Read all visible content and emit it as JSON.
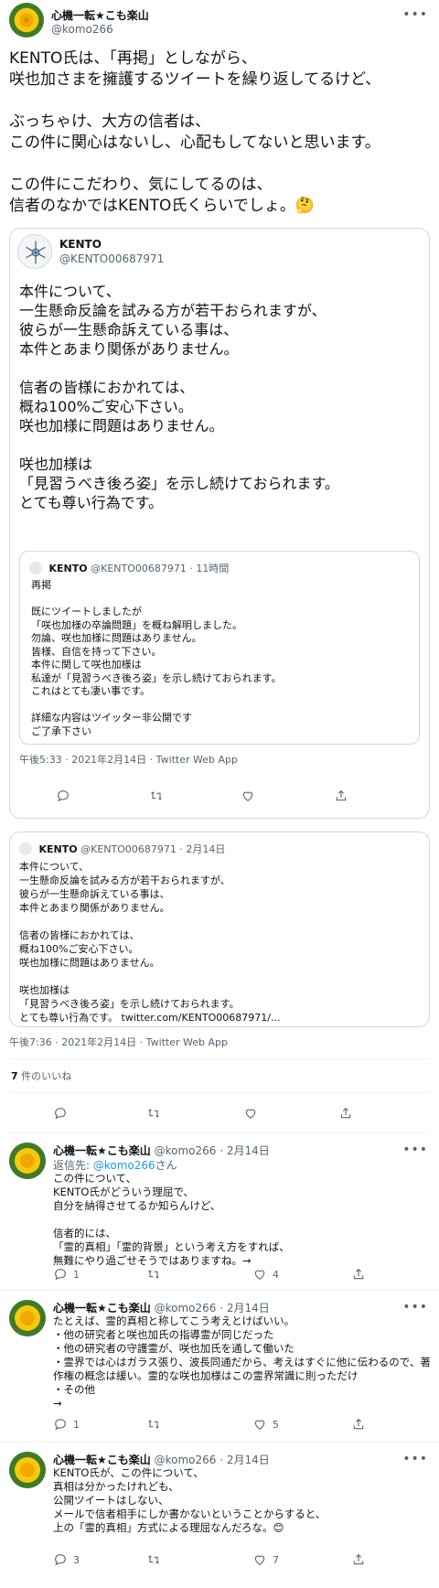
{
  "main": {
    "name": "心機一転★こも楽山",
    "handle": "@komo266",
    "text": "KENTO氏は、「再掲」としながら、\n咲也加さまを擁護するツイートを繰り返してるけど、\n\nぶっちゃけ、大方の信者は、\nこの件に関心はないし、心配もしてないと思います。\n\nこの件にこだわり、気にしてるのは、\n信者のなかではKENTO氏くらいでしょ。🤔",
    "time": "午後7:36 · 2021年2月14日 · Twitter Web App",
    "likes_count": "7",
    "likes_label": " 件のいいね"
  },
  "quote_big": {
    "name": "KENTO",
    "handle": "@KENTO00687971",
    "text": "本件について、\n一生懸命反論を試みる方が若干おられますが、\n彼らが一生懸命訴えている事は、\n本件とあまり関係がありません。\n\n信者の皆様におかれては、\n概ね100%ご安心下さい。\n咲也加様に問題はありません。\n\n咲也加様は\n「見習うべき後ろ姿」を示し続けておられます。\nとても尊い行為です。",
    "time": "午後5:33 · 2021年2月14日 · Twitter Web App",
    "inner": {
      "name": "KENTO",
      "handle": "@KENTO00687971 · 11時間",
      "text": "再掲\n\n既にツイートしましたが\n「咲也加様の卒論問題」を概ね解明しました。\n勿論、咲也加様に問題はありません。\n皆様、自信を持って下さい。\n本件に関して咲也加様は\n私達が「見習うべき後ろ姿」を示し続けておられます。\nこれはとても凄い事です。\n\n詳細な内容はツイッター非公開です\nご了承下さい"
    }
  },
  "quote_small": {
    "name": "KENTO",
    "handle": "@KENTO00687971 · 2月14日",
    "text": "本件について、\n一生懸命反論を試みる方が若干おられますが、\n彼らが一生懸命訴えている事は、\n本件とあまり関係がありません。\n\n信者の皆様におかれては、\n概ね100%ご安心下さい。\n咲也加様に問題はありません。\n\n咲也加様は\n「見習うべき後ろ姿」を示し続けておられます。\nとても尊い行為です。 twitter.com/KENTO00687971/..."
  },
  "replies": [
    {
      "name": "心機一転★こも楽山",
      "handle": "@komo266 · 2月14日",
      "replyto_prefix": "返信先: ",
      "replyto_handle": "@komo266",
      "replyto_suffix": "さん",
      "text": "この件について、\nKENTO氏がどういう理屈で、\n自分を納得させてるか知らんけど、\n\n信者的には、\n「霊的真相」「霊的背景」という考え方をすれば、\n無難にやり過ごせそうではありますね。→",
      "reply_count": "1",
      "like_count": "4"
    },
    {
      "name": "心機一転★こも楽山",
      "handle": "@komo266 · 2月14日",
      "text": "たとえば、霊的真相と称してこう考えとけばいい。\n・他の研究者と咲也加氏の指導霊が同じだった\n・他の研究者の守護霊が、咲也加氏を通して働いた\n・霊界では心はガラス張り、波長同通だから、考えはすぐに他に伝わるので、著作権の概念は緩い。霊的な咲也加様はこの霊界常識に則っただけ\n・その他\n→",
      "reply_count": "1",
      "like_count": "5"
    },
    {
      "name": "心機一転★こも楽山",
      "handle": "@komo266 · 2月14日",
      "text": "KENTO氏が、この件について、\n真相は分かったけれども、\n公開ツイートはしない、\nメールで信者相手にしか書かないということからすると、\n上の「霊的真相」方式による理屈なんだろな。😊",
      "reply_count": "3",
      "like_count": "7"
    }
  ],
  "colors": {
    "text": "#0f1419",
    "secondary": "#536471",
    "link": "#1d9bf0",
    "border": "#cfd9de",
    "avatar_yellow": "#f3d13a"
  },
  "icons": [
    "more-icon",
    "reply-icon",
    "retweet-icon",
    "like-icon",
    "share-icon",
    "kento-logo-icon"
  ]
}
